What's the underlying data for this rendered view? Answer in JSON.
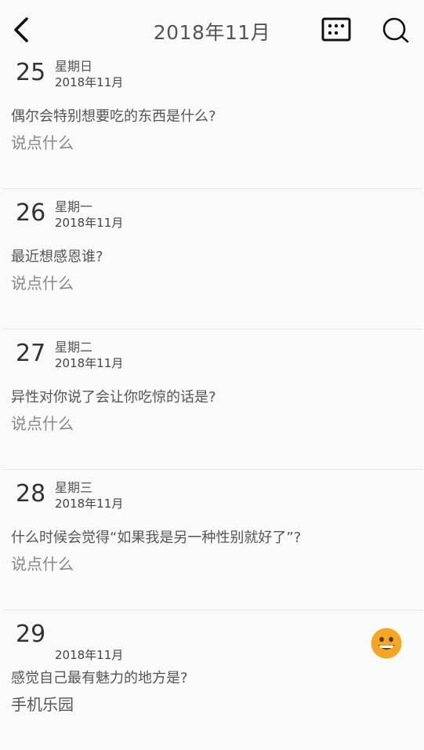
{
  "header": {
    "title": "2018年11月"
  },
  "entries": [
    {
      "day": "25",
      "weekday": "星期日",
      "month": "2018年11月",
      "question": "偶尔会特别想要吃的东西是什么?",
      "reply": "说点什么"
    },
    {
      "day": "26",
      "weekday": "星期一",
      "month": "2018年11月",
      "question": "最近想感恩谁?",
      "reply": "说点什么"
    },
    {
      "day": "27",
      "weekday": "星期二",
      "month": "2018年11月",
      "question": "异性对你说了会让你吃惊的话是?",
      "reply": "说点什么"
    },
    {
      "day": "28",
      "weekday": "星期三",
      "month": "2018年11月",
      "question": "什么时候会觉得“如果我是另一种性别就好了”?",
      "reply": "说点什么"
    },
    {
      "day": "29",
      "month": "2018年11月",
      "question": "感觉自己最有魅力的地方是?",
      "reply": "手机乐园",
      "mood": "smile-emoji-icon"
    }
  ],
  "colors": {
    "text": "#333333",
    "muted": "#888888",
    "emoji": "#F5A623",
    "divider": "#E6E6E6"
  }
}
